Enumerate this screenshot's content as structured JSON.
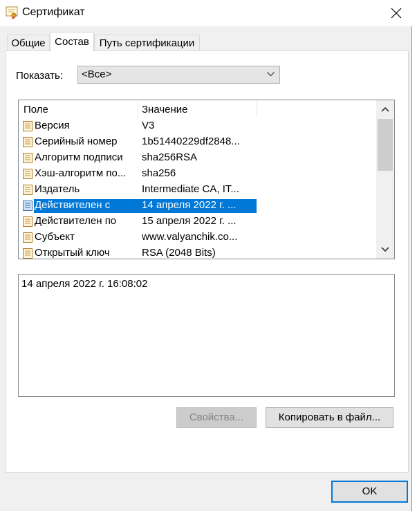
{
  "window": {
    "title": "Сертификат",
    "title_icon": "certificate-icon",
    "close_icon": "close-icon"
  },
  "tabs": [
    {
      "label": "Общие",
      "active": false
    },
    {
      "label": "Состав",
      "active": true
    },
    {
      "label": "Путь сертификации",
      "active": false
    }
  ],
  "show": {
    "label": "Показать:",
    "selected": "<Все>"
  },
  "list": {
    "columns": [
      "Поле",
      "Значение"
    ],
    "rows": [
      {
        "field": "Версия",
        "value": "V3"
      },
      {
        "field": "Серийный номер",
        "value": "1b51440229df2848..."
      },
      {
        "field": "Алгоритм подписи",
        "value": "sha256RSA"
      },
      {
        "field": "Хэш-алгоритм по...",
        "value": "sha256"
      },
      {
        "field": "Издатель",
        "value": "Intermediate CA, IT..."
      },
      {
        "field": "Действителен с",
        "value": "14 апреля 2022 г. ...",
        "selected": true
      },
      {
        "field": "Действителен по",
        "value": "15 апреля 2022 г. ..."
      },
      {
        "field": "Субъект",
        "value": "www.valyanchik.co..."
      },
      {
        "field": "Открытый ключ",
        "value": "RSA (2048 Bits)"
      }
    ]
  },
  "detail": {
    "text": "14 апреля 2022 г. 16:08:02"
  },
  "buttons": {
    "properties": "Свойства...",
    "copy_to_file": "Копировать в файл...",
    "ok": "OK"
  },
  "colors": {
    "selection": "#0078d7",
    "dialog_bg": "#f0f0f0",
    "default_button_border": "#0078d7"
  }
}
